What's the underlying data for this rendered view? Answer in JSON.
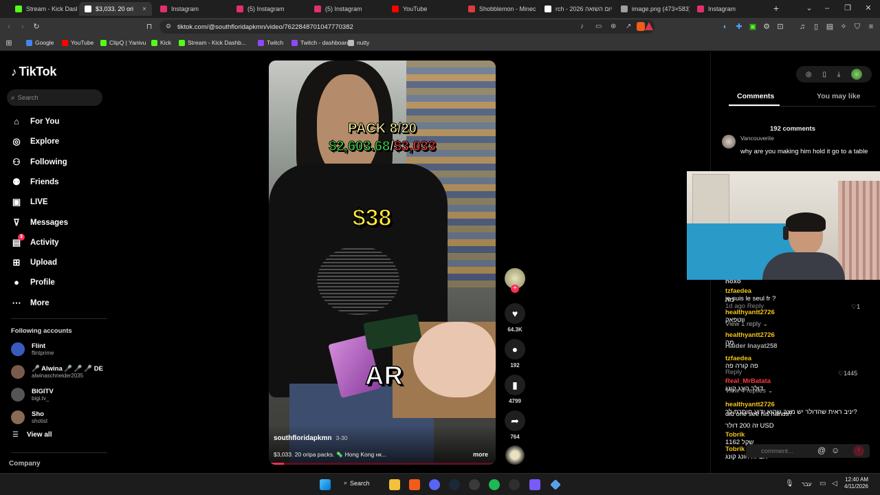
{
  "browser": {
    "tabs": [
      {
        "label": "Stream - Kick Dashbo",
        "color": "#53fc18",
        "active": false
      },
      {
        "label": "$3,033. 20 ori",
        "color": "#ffffff",
        "active": true
      },
      {
        "label": "Instagram",
        "color": "#e1306c",
        "active": false
      },
      {
        "label": "(5) Instagram",
        "color": "#e1306c",
        "active": false
      },
      {
        "label": "(5) Instagram",
        "color": "#e1306c",
        "active": false
      },
      {
        "label": "YouTube",
        "color": "#ff0000",
        "active": false
      },
      {
        "label": "Shobblemon - Minec",
        "color": "#e03a3a",
        "active": false
      },
      {
        "label": "rch - 2026 יום השואה",
        "color": "#ffffff",
        "active": false
      },
      {
        "label": "image.png (473×583)",
        "color": "#9aa0a6",
        "active": false
      },
      {
        "label": "Instagram",
        "color": "#e1306c",
        "active": false
      }
    ],
    "url": "tiktok.com/@southfloridapkmn/video/7622848701047770382",
    "bookmarks": [
      {
        "label": "Google",
        "color": "#4285f4"
      },
      {
        "label": "YouTube",
        "color": "#ff0000"
      },
      {
        "label": "ClipQ | Yanivu",
        "color": "#53fc18"
      },
      {
        "label": "Kick",
        "color": "#53fc18"
      },
      {
        "label": "Stream - Kick Dashb...",
        "color": "#53fc18"
      },
      {
        "label": "Twitch",
        "color": "#9146ff"
      },
      {
        "label": "Twitch - dashboard",
        "color": "#9146ff"
      },
      {
        "label": "nutty",
        "color": "#bbbbbb"
      }
    ]
  },
  "tiktok": {
    "logo": "TikTok",
    "search_placeholder": "Search",
    "nav": [
      {
        "label": "For You",
        "icon": "home-icon",
        "glyph": "⌂"
      },
      {
        "label": "Explore",
        "icon": "compass-icon",
        "glyph": "◎"
      },
      {
        "label": "Following",
        "icon": "following-icon",
        "glyph": "⚇"
      },
      {
        "label": "Friends",
        "icon": "friends-icon",
        "glyph": "⚉"
      },
      {
        "label": "LIVE",
        "icon": "live-icon",
        "glyph": "▣"
      },
      {
        "label": "Messages",
        "icon": "messages-icon",
        "glyph": "⊽"
      },
      {
        "label": "Activity",
        "icon": "activity-icon",
        "glyph": "▤",
        "badge": "3"
      },
      {
        "label": "Upload",
        "icon": "upload-icon",
        "glyph": "⊞"
      },
      {
        "label": "Profile",
        "icon": "profile-icon",
        "glyph": "●"
      },
      {
        "label": "More",
        "icon": "more-icon",
        "glyph": "⋯"
      }
    ],
    "following_title": "Following accounts",
    "accounts": [
      {
        "name": "Flint",
        "handle": "flintprime",
        "color": "#3a5bbd"
      },
      {
        "name": "🎤 Alwina 🎤 🎤 🎤 DE",
        "handle": "alwinaschneider2035",
        "color": "#7a5a4a"
      },
      {
        "name": "BIGITV",
        "handle": "bigi.tv_",
        "color": "#555555"
      },
      {
        "name": "Sho",
        "handle": "shotist",
        "color": "#8a6a55"
      }
    ],
    "view_all": "View all",
    "company": "Company",
    "video": {
      "pack_text": "PACK 8/20",
      "amount_green": "$2,603.68",
      "slash": "/",
      "amount_red": "$3,033",
      "price": "$38",
      "card_label": "AR",
      "author": "southfloridapkmn",
      "date": "3-30",
      "caption": "$3,033. 20 oripa packs. 🦠 Hong Kong нк...",
      "more": "more"
    },
    "actions": {
      "likes": "64.3K",
      "comments": "192",
      "saves": "4799",
      "shares": "764"
    },
    "comments_tab": "Comments",
    "you_may_like_tab": "You may like",
    "comments_count": "192 comments",
    "first_comment": {
      "user": "Vancouverite",
      "text": "why are you making him hold it go to a table"
    },
    "comment_placeholder": "comment..."
  },
  "chat_overlay": [
    {
      "user": "noxo",
      "color": "#cccccc",
      "text": ""
    },
    {
      "user": "tzfaedea",
      "color": "#f5c518",
      "text": "je suis le seul fr ?"
    },
    {
      "user": "",
      "color": "#ffffff",
      "text": "מה"
    },
    {
      "user": "",
      "color": "#888888",
      "text": "1d ago   Reply"
    },
    {
      "user": "healthyantt2726",
      "color": "#f5c518",
      "text": "ווטפאק"
    },
    {
      "user": "",
      "color": "#aaaaaa",
      "text": "View 1 reply ⌄"
    },
    {
      "user": "healthyantt2726",
      "color": "#f5c518",
      "text": "מה"
    },
    {
      "user": "Haider Inayat258",
      "color": "#aaaaaa",
      "text": ""
    },
    {
      "user": "tzfaedea",
      "color": "#f5c518",
      "text": "פה קורה פה"
    },
    {
      "user": "",
      "color": "#888888",
      "text": "Reply"
    },
    {
      "user": "Real_MrBatata",
      "color": "#ff3b3b",
      "text": "דולר הונג קונג"
    },
    {
      "user": "",
      "color": "#aaaaaa",
      "text": "View 4 replies ⌄"
    },
    {
      "user": "healthyantt2726",
      "color": "#f5c518",
      "text": "יניב ראית שהדולר יש מצב שהוא ידוע חותרת לך?"
    },
    {
      "user": "",
      "color": "#ffffff",
      "text": "did one see his hands?"
    },
    {
      "user": "",
      "color": "#ffffff",
      "text": "זה 200 דולר USD"
    },
    {
      "user": "Tobrik",
      "color": "#f5c518",
      "text": "שקל 1162"
    },
    {
      "user": "Tobrik",
      "color": "#f5c518",
      "text": "אם זה הונג קונג"
    }
  ],
  "chat_meta": {
    "likes_1": "1",
    "likes_1445": "1445"
  },
  "taskbar": {
    "search": "Search",
    "lang": "עבר",
    "time": "12:40 AM",
    "date": "4/11/2026"
  }
}
